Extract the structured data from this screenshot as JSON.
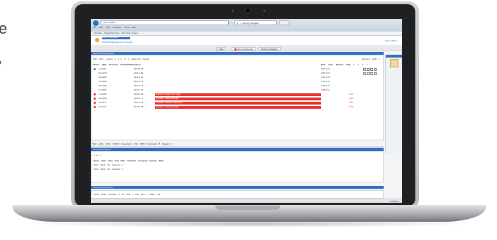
{
  "side_text": [
    "e",
    ","
  ],
  "browser": {
    "address": "http://  /portal  ",
    "search": "Q · ‹ · Energy Navigator",
    "menu": "File  Edit  View  Favorites  Tools  Help",
    "favorites": "Favorites  ·  Suggested Sites  ·  Web Slice Gallery"
  },
  "app": {
    "title": "Energy Navigator",
    "subtitle": "Workflow Management   Forecast",
    "header_right": "Clear Filters ›"
  },
  "tabs": [
    {
      "label": "Start",
      "active": false
    },
    {
      "label": "Forecast Review",
      "active": true,
      "flag": true
    },
    {
      "label": "Review Navigator",
      "active": false
    }
  ],
  "main_panel": {
    "title": "Forecast Management",
    "toolbar": "Well   Filter Loaded ▾   ◂ ▸ ⟲ ⎙   Advanced Search",
    "toolbar_right": "Selected Wells ▾",
    "columns": "Status   Well   Forecast   Schedule/Exception",
    "right_columns": "Rate   Cum   Decline   Flag   ✓ ✓ ✓ ✓"
  },
  "rows": [
    {
      "status_color": "#3a78d6",
      "name": "TL-0012",
      "values": "2013   3.45",
      "error": false,
      "right": "3.62   0.15"
    },
    {
      "status_color": "",
      "name": "NA-0074",
      "values": "2011   4.80",
      "error": false,
      "right": "2.87   0.24"
    },
    {
      "status_color": "",
      "name": "FR-0081",
      "values": "2012   3.01",
      "error": false,
      "right": "3.10   0.18"
    },
    {
      "status_color": "",
      "name": "PF-0066",
      "values": "2010   2.75",
      "error": false,
      "right": "2.41   0.20"
    },
    {
      "status_color": "",
      "name": "RN-0043",
      "values": "2011   5.12",
      "error": false,
      "right": "4.98   0.31"
    },
    {
      "status_color": "",
      "name": "GT-0057",
      "values": "2012   1.92",
      "error": false,
      "right": "1.88   0.11"
    },
    {
      "status_color": "#e02020",
      "name": "TL-0098",
      "values": "2013   0.84",
      "error": true,
      "error_text": "Exception: decline out of range",
      "right": "",
      "red": "0.12"
    },
    {
      "status_color": "#e02020",
      "name": "NA-0103",
      "values": "2012   0.77",
      "error": true,
      "error_text": "Exception: missing rate data",
      "right": "",
      "red": "0.09"
    },
    {
      "status_color": "#e02020",
      "name": "FR-0117",
      "values": "2011   0.69",
      "error": true,
      "error_text": "Exception: forecast not approved",
      "right": "",
      "red": "0.14"
    },
    {
      "status_color": "#e02020",
      "name": "PF-0121",
      "values": "2013   0.58",
      "error": true,
      "error_text": "Exception: schedule overdue",
      "right": "",
      "red": "0.10"
    }
  ],
  "summary": "Total wells  12/12 (100%)   Exceptions  4/12 (33%)   Reviewed  8   Flagged  4",
  "sub_panel": {
    "title": "Forecast Properties",
    "lines": [
      "◂ ▸  ⎙",
      "Name   Start Date   End Date   Duration   Assigned   Include   Mark",
      "       2013   2014   3.5       Forecast            ▾",
      "       2012   2013   2.0       Forecast            ▾"
    ]
  },
  "foot_panel": {
    "title": "Forecast Comparison",
    "line": "Group   Base Scenario ▾     Oil   19.8  |  Gas   28.3  |  Water   8.1"
  },
  "status_bar": "⊕ 100% ▾"
}
